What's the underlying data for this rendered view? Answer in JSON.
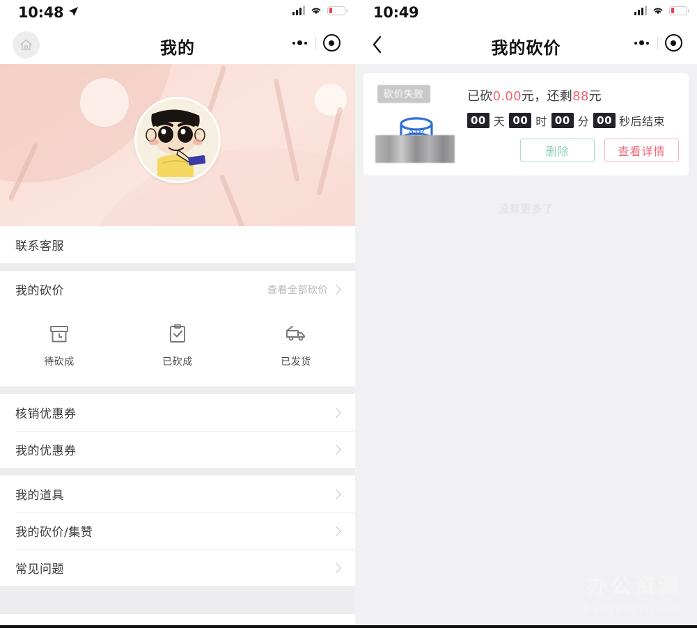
{
  "left": {
    "status_bar": {
      "time": "10:48",
      "location_icon": "location-arrow-icon",
      "signal_icon": "signal-bars-icon",
      "wifi_icon": "wifi-icon",
      "battery_icon": "battery-low-icon"
    },
    "nav": {
      "home_icon": "home-icon",
      "title": "我的",
      "more_icon": "more-dots-icon",
      "target_icon": "target-circle-icon"
    },
    "profile": {
      "avatar_alt": "crayon-shinchan-avatar",
      "username": ""
    },
    "rows": {
      "contact_service": "联系客服",
      "my_bargain": "我的砍价",
      "view_all_bargain": "查看全部砍价",
      "redeem_coupon": "核销优惠券",
      "my_coupon": "我的优惠券",
      "my_props": "我的道具",
      "my_bargain_likes": "我的砍价/集赞",
      "faq": "常见问题"
    },
    "status_cells": [
      {
        "icon": "pending-box-clock-icon",
        "label": "待砍成"
      },
      {
        "icon": "clipboard-check-icon",
        "label": "已砍成"
      },
      {
        "icon": "delivery-truck-icon",
        "label": "已发货"
      }
    ]
  },
  "right": {
    "status_bar": {
      "time": "10:49",
      "signal_icon": "signal-bars-icon",
      "wifi_icon": "wifi-icon",
      "battery_icon": "battery-low-icon"
    },
    "nav": {
      "back_icon": "chevron-left-icon",
      "title": "我的砍价",
      "more_icon": "more-dots-icon",
      "target_icon": "target-circle-icon"
    },
    "card": {
      "fail_badge": "砍价失败",
      "product_logo": "AIR",
      "price_prefix": "已砍",
      "price_cut": "0.00",
      "price_unit": "元，",
      "remain_prefix": "还剩",
      "remain_value": "88",
      "remain_unit": "元",
      "countdown": {
        "days": "00",
        "days_unit": "天",
        "hours": "00",
        "hours_unit": "时",
        "minutes": "00",
        "minutes_unit": "分",
        "seconds": "00",
        "tail": "秒后结束"
      },
      "delete_label": "删除",
      "detail_label": "查看详情"
    },
    "no_more": "没有更多了",
    "watermark_line1": "办公资源",
    "watermark_line2": "bangongziyuan"
  },
  "colors": {
    "accent_red": "#f5616f",
    "accent_green": "#8ed0b6",
    "banner_pink": "#fae0d8",
    "badge_dark": "#232229",
    "page_bg": "#f1f1f3"
  }
}
